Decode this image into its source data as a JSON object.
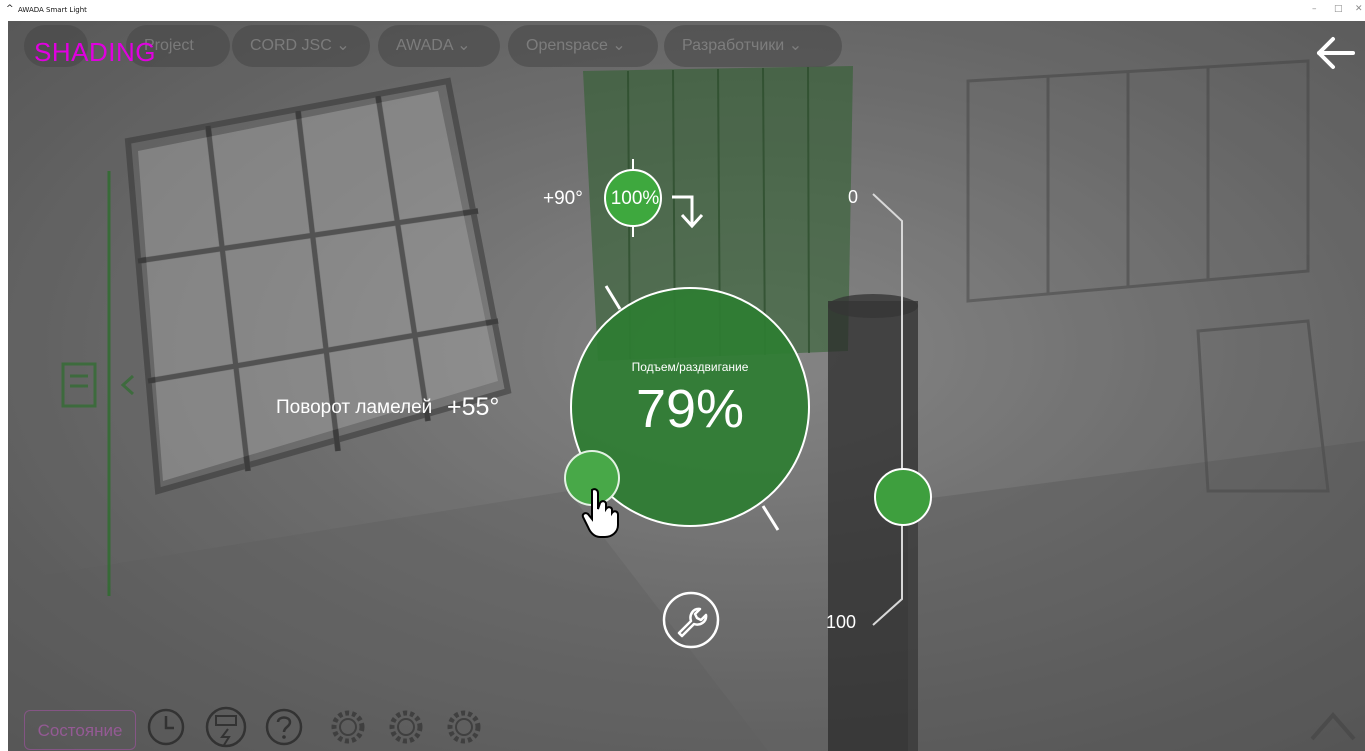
{
  "window": {
    "title": "AWADA Smart Light",
    "controls": [
      "–",
      "□",
      "✕"
    ]
  },
  "header": {
    "mode_title": "SHADING",
    "breadcrumbs": [
      {
        "label": "Project"
      },
      {
        "label": "CORD JSC"
      },
      {
        "label": "AWADA"
      },
      {
        "label": "Openspace"
      },
      {
        "label": "Разработчики"
      }
    ],
    "back_icon": "arrow-left-icon"
  },
  "lamella": {
    "label": "Поворот ламелей",
    "angle": "+55°",
    "max_angle": "+90°",
    "max_percent": "100%"
  },
  "lift": {
    "label": "Подъем/раздвигание",
    "value": "79%",
    "value_fraction": 0.79
  },
  "slider": {
    "min_label": "0",
    "max_label": "100",
    "value_fraction": 0.72
  },
  "footer": {
    "status_label": "Состояние",
    "icons": [
      "clock-icon",
      "power-meter-icon",
      "help-icon",
      "gear-1-icon",
      "gear-2-icon",
      "gear-3-icon"
    ],
    "settings_icon": "wrench-icon",
    "expand_icon": "chevron-up-icon"
  },
  "colors": {
    "accent_green": "#3e9f3e",
    "main_circle": "#2e7d32",
    "title_magenta": "#e000e0"
  }
}
